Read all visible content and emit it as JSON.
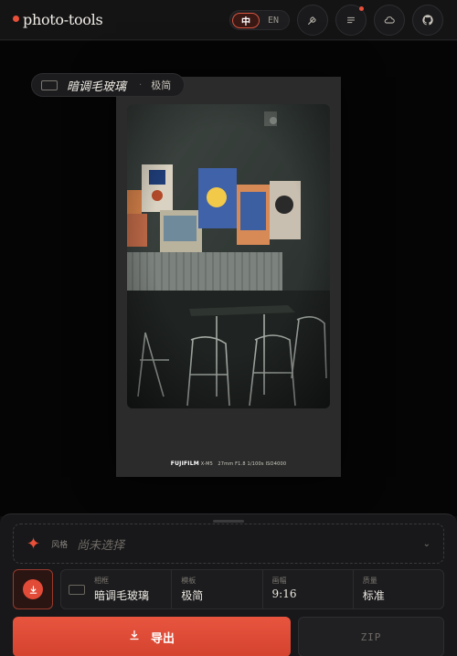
{
  "header": {
    "logo_text": "photo-tools",
    "lang_options": [
      "中",
      "EN"
    ],
    "active_lang": "中",
    "icons": [
      "tool-icon",
      "list-icon",
      "cloud-icon",
      "github-icon"
    ]
  },
  "preview": {
    "preset_name": "暗调毛玻璃",
    "preset_separator": "·",
    "preset_style": "极简",
    "exif_brand": "FUJIFILM",
    "exif_model": "X-M5",
    "exif_params": "27mm F1.8 1/100s ISO4000"
  },
  "panel": {
    "style_label": "风格",
    "style_value": "尚未选择",
    "cells": [
      {
        "key": "相框",
        "value": "暗调毛玻璃"
      },
      {
        "key": "模板",
        "value": "极简"
      },
      {
        "key": "画幅",
        "value": "9:16"
      },
      {
        "key": "质量",
        "value": "标准"
      }
    ],
    "export_label": "导出",
    "zip_label": "ZIP"
  },
  "colors": {
    "accent": "#e8503a",
    "background": "#0e0e0f"
  }
}
